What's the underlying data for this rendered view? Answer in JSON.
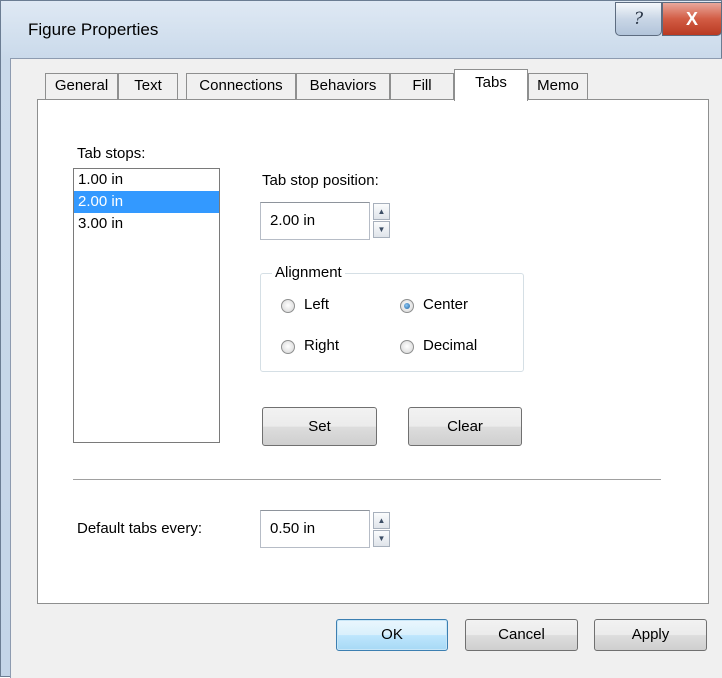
{
  "window": {
    "title": "Figure Properties",
    "help_glyph": "?",
    "close_glyph": "X"
  },
  "tabs": [
    {
      "label": "General",
      "active": false
    },
    {
      "label": "Text",
      "active": false
    },
    {
      "label": "Connections",
      "active": false
    },
    {
      "label": "Behaviors",
      "active": false
    },
    {
      "label": "Fill",
      "active": false
    },
    {
      "label": "Tabs",
      "active": true
    },
    {
      "label": "Memo",
      "active": false
    }
  ],
  "tab_stops": {
    "label": "Tab stops:",
    "items": [
      "1.00 in",
      "2.00 in",
      "3.00 in"
    ],
    "selected_index": 1
  },
  "position": {
    "label": "Tab stop position:",
    "value": "2.00 in"
  },
  "alignment": {
    "legend": "Alignment",
    "options": [
      "Left",
      "Center",
      "Right",
      "Decimal"
    ],
    "selected": "Center"
  },
  "actions": {
    "set_label": "Set",
    "clear_label": "Clear"
  },
  "default_tabs": {
    "label": "Default tabs every:",
    "value": "0.50 in"
  },
  "footer": {
    "ok_label": "OK",
    "cancel_label": "Cancel",
    "apply_label": "Apply"
  },
  "icons": {
    "spin_up": "spin-up-icon",
    "spin_down": "spin-down-icon",
    "help": "help-icon",
    "close": "close-icon"
  },
  "colors": {
    "selection": "#3399ff",
    "default_button": "#3c7fb1"
  }
}
